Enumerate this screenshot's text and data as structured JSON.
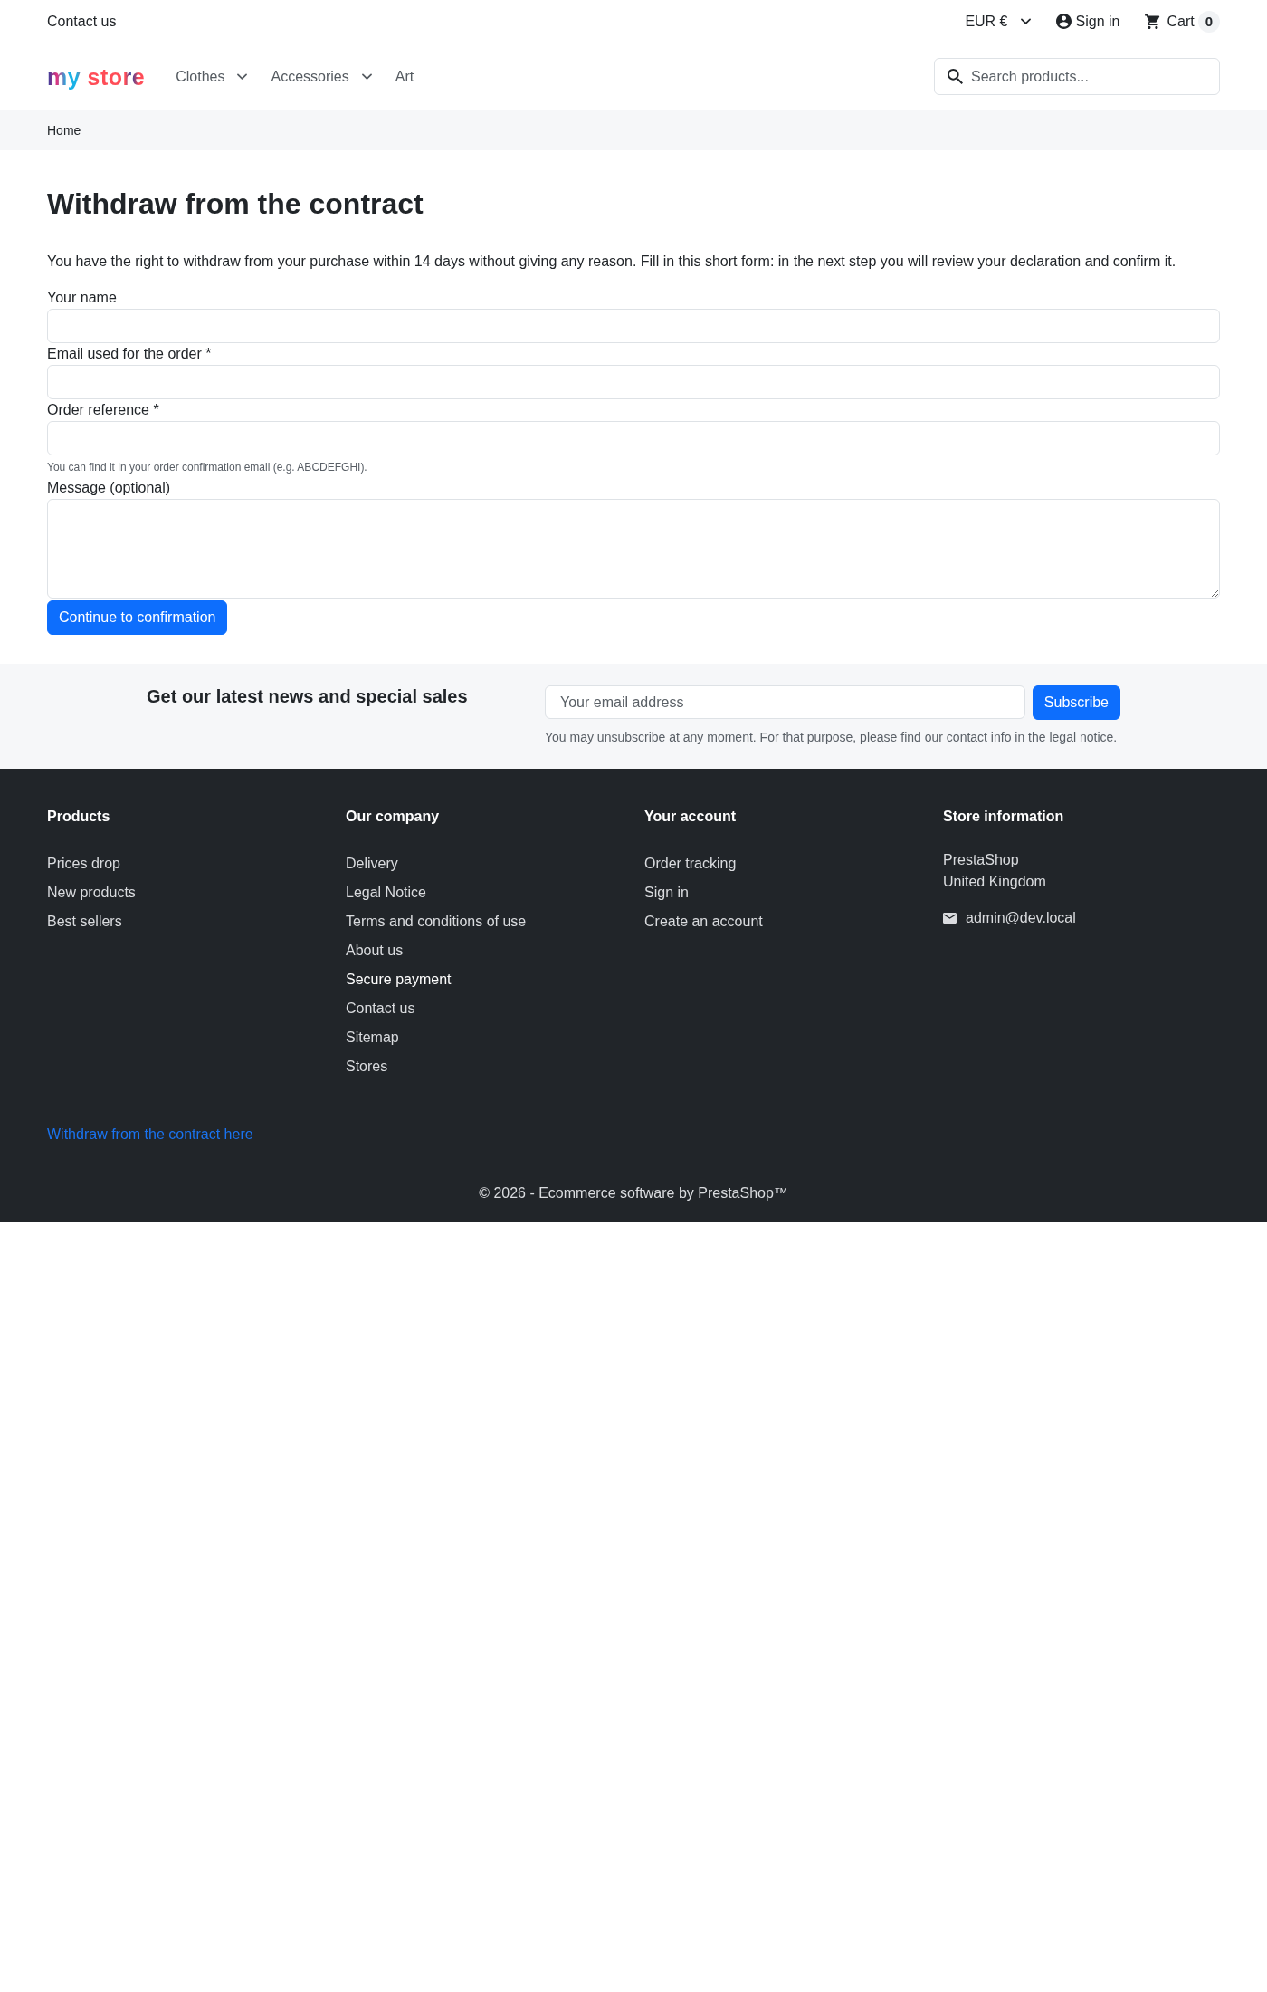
{
  "top_bar": {
    "contact_link": "Contact us",
    "currency": "EUR €",
    "sign_in": "Sign in",
    "cart": {
      "label": "Cart",
      "count": "0"
    }
  },
  "navbar": {
    "logo": "my store",
    "menu": [
      {
        "label": "Clothes",
        "has_submenu": true
      },
      {
        "label": "Accessories",
        "has_submenu": true
      },
      {
        "label": "Art",
        "has_submenu": false
      }
    ],
    "search": {
      "placeholder": "Search products..."
    }
  },
  "breadcrumb": [
    {
      "label": "Home"
    }
  ],
  "page": {
    "title": "Withdraw from the contract",
    "intro": "You have the right to withdraw from your purchase within 14 days without giving any reason. Fill in this short form: in the next step you will review your declaration and confirm it.",
    "fields": [
      {
        "kind": "input",
        "label": "Your name"
      },
      {
        "kind": "input",
        "label": "Email used for the order *"
      },
      {
        "kind": "input",
        "label": "Order reference *",
        "help": "You can find it in your order confirmation email (e.g. ABCDEFGHI)."
      },
      {
        "kind": "textarea",
        "label": "Message (optional)"
      }
    ],
    "submit": "Continue to confirmation"
  },
  "newsletter": {
    "heading": "Get our latest news and special sales",
    "placeholder": "Your email address",
    "button": "Subscribe",
    "note": "You may unsubscribe at any moment. For that purpose, please find our contact info in the legal notice."
  },
  "footer": {
    "columns": [
      {
        "title": "Products",
        "links": [
          {
            "label": "Prices drop",
            "highlighted": false
          },
          {
            "label": "New products",
            "highlighted": false
          },
          {
            "label": "Best sellers",
            "highlighted": false
          }
        ]
      },
      {
        "title": "Our company",
        "links": [
          {
            "label": "Delivery",
            "highlighted": false
          },
          {
            "label": "Legal Notice",
            "highlighted": false
          },
          {
            "label": "Terms and conditions of use",
            "highlighted": false
          },
          {
            "label": "About us",
            "highlighted": false
          },
          {
            "label": "Secure payment",
            "highlighted": true
          },
          {
            "label": "Contact us",
            "highlighted": false
          },
          {
            "label": "Sitemap",
            "highlighted": false
          },
          {
            "label": "Stores",
            "highlighted": false
          }
        ]
      },
      {
        "title": "Your account",
        "links": [
          {
            "label": "Order tracking",
            "highlighted": false
          },
          {
            "label": "Sign in",
            "highlighted": false
          },
          {
            "label": "Create an account",
            "highlighted": false
          }
        ]
      }
    ],
    "store_info": {
      "title": "Store information",
      "lines": [
        "PrestaShop",
        "United Kingdom"
      ],
      "email": "admin@dev.local"
    },
    "withdraw_link": "Withdraw from the contract here",
    "copyright": "© 2026 - Ecommerce software by PrestaShop™"
  }
}
